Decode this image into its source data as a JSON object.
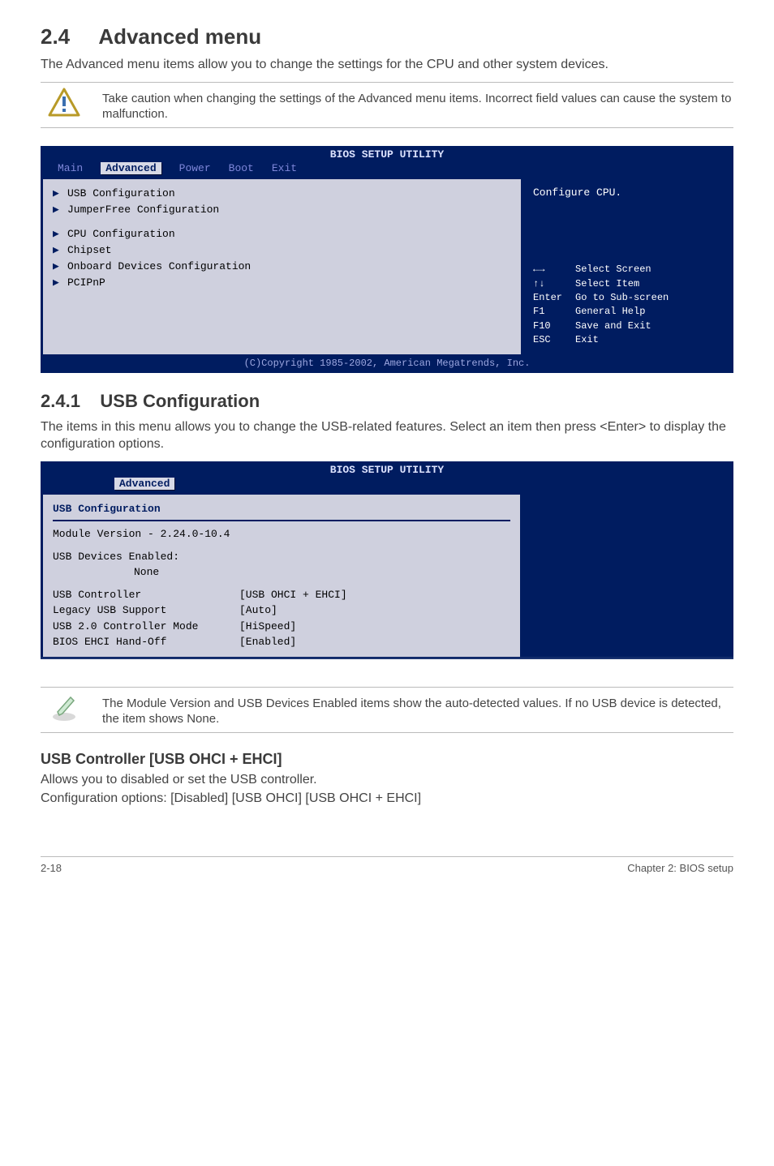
{
  "page": {
    "section_number": "2.4",
    "section_title": "Advanced menu",
    "intro": "The Advanced menu items allow you to change the settings for the CPU and other system devices.",
    "caution": "Take caution when changing the settings of the Advanced menu items. Incorrect field values can cause the system to malfunction.",
    "subsection_number": "2.4.1",
    "subsection_title": "USB Configuration",
    "subsection_intro": "The items in this menu allows you to change the USB-related features. Select an item then press <Enter> to display the configuration options.",
    "note": "The Module Version and USB Devices Enabled items show the auto-detected values. If no USB device is detected, the item shows None.",
    "config_heading": "USB Controller [USB OHCI + EHCI]",
    "config_line1": "Allows you to disabled or set the USB controller.",
    "config_line2": "Configuration options: [Disabled] [USB OHCI] [USB OHCI + EHCI]",
    "footer_left": "2-18",
    "footer_right": "Chapter 2: BIOS setup"
  },
  "bios_main": {
    "title": "BIOS SETUP UTILITY",
    "tabs": [
      "Main",
      "Advanced",
      "Power",
      "Boot",
      "Exit"
    ],
    "active_tab": "Advanced",
    "left_group1": [
      "USB Configuration",
      "JumperFree Configuration"
    ],
    "left_group2": [
      "CPU Configuration",
      "Chipset",
      "Onboard Devices Configuration",
      "PCIPnP"
    ],
    "right_help_top": "Configure CPU.",
    "help_keys": [
      {
        "key": "←→",
        "label": "Select Screen"
      },
      {
        "key": "↑↓",
        "label": "Select Item"
      },
      {
        "key": "Enter",
        "label": "Go to Sub-screen"
      },
      {
        "key": "F1",
        "label": "General Help"
      },
      {
        "key": "F10",
        "label": "Save and Exit"
      },
      {
        "key": "ESC",
        "label": "Exit"
      }
    ],
    "footer": "(C)Copyright 1985-2002, American Megatrends, Inc."
  },
  "bios_usb": {
    "title": "BIOS SETUP UTILITY",
    "active_tab": "Advanced",
    "header": "USB Configuration",
    "module_line": "Module Version - 2.24.0-10.4",
    "devices_label": "USB Devices Enabled:",
    "devices_value": "None",
    "rows": [
      {
        "k": "USB Controller",
        "v": "[USB OHCI + EHCI]"
      },
      {
        "k": "Legacy USB Support",
        "v": "[Auto]"
      },
      {
        "k": "USB 2.0 Controller Mode",
        "v": "[HiSpeed]"
      },
      {
        "k": "BIOS EHCI Hand-Off",
        "v": "[Enabled]"
      }
    ]
  }
}
